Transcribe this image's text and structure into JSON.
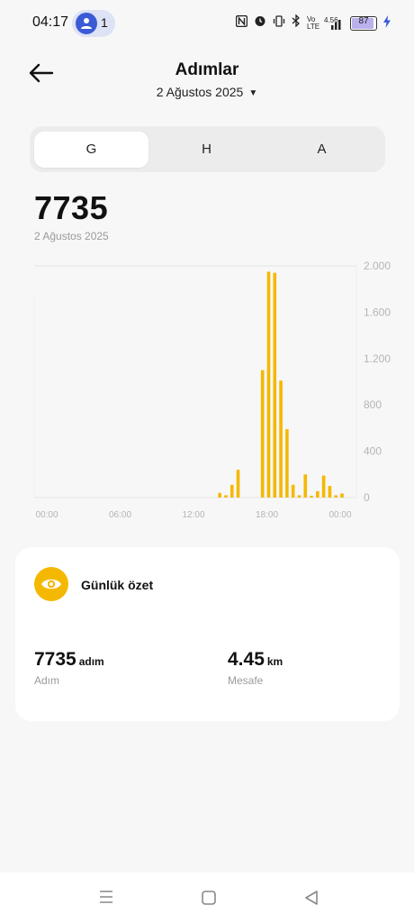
{
  "status_bar": {
    "time": "04:17",
    "hotspot_count": "1",
    "icons": [
      "nfc-icon",
      "alarm-icon",
      "vibrate-icon",
      "bluetooth-icon",
      "volte-icon",
      "signal-icon"
    ],
    "volte_text": "Vo LTE",
    "net_speed": "4.56",
    "battery_level": "87",
    "battery_fraction": 0.87
  },
  "header": {
    "title": "Adımlar",
    "date": "2 Ağustos 2025"
  },
  "tabs": [
    {
      "label": "G",
      "active": true
    },
    {
      "label": "H",
      "active": false
    },
    {
      "label": "A",
      "active": false
    }
  ],
  "total": {
    "value": "7735",
    "date": "2 Ağustos 2025"
  },
  "chart_data": {
    "type": "bar",
    "x_tick_labels": [
      "00:00",
      "06:00",
      "12:00",
      "18:00",
      "00:00"
    ],
    "y_tick_labels": [
      "2.000",
      "1.600",
      "1.200",
      "800",
      "400",
      "0"
    ],
    "ylim": [
      0,
      2000
    ],
    "y_ticks": [
      0,
      400,
      800,
      1200,
      1600,
      2000
    ],
    "bar_color": "#f5b800",
    "hours": [
      14.0,
      14.5,
      15.0,
      15.5,
      17.5,
      18.0,
      18.5,
      19.0,
      19.5,
      20.0,
      20.5,
      21.0,
      21.5,
      22.0,
      22.5,
      23.0,
      23.5,
      24.0
    ],
    "values": [
      40,
      20,
      110,
      240,
      1100,
      1950,
      1940,
      1010,
      590,
      110,
      20,
      200,
      15,
      55,
      190,
      100,
      20,
      35
    ]
  },
  "summary": {
    "title": "Günlük özet",
    "steps_value": "7735",
    "steps_unit": "adım",
    "steps_label": "Adım",
    "distance_value": "4.45",
    "distance_unit": "km",
    "distance_label": "Mesafe"
  },
  "colors": {
    "accent": "#f5b800",
    "background": "#f7f7f7"
  }
}
